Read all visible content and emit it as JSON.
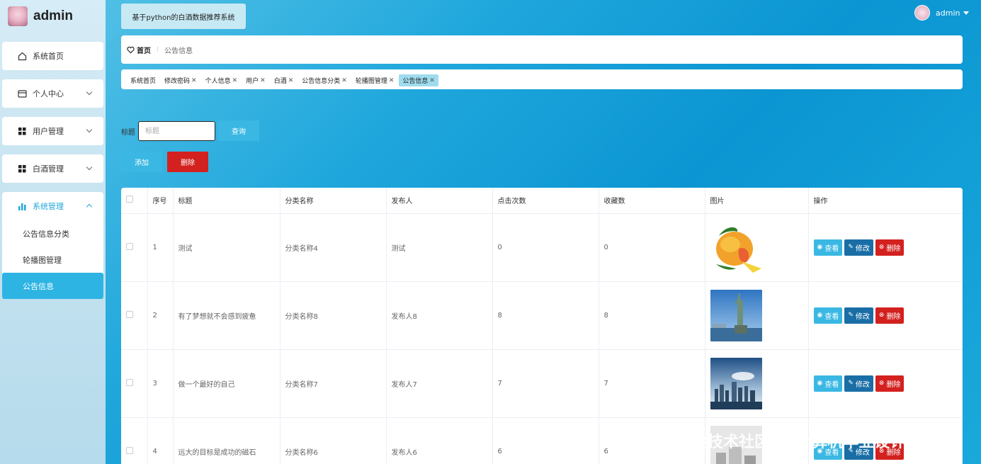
{
  "brand": {
    "title": "admin"
  },
  "header": {
    "system_title": "基于python的白酒数据推荐系统",
    "username": "admin"
  },
  "sidebar": {
    "items": [
      {
        "label": "系统首页",
        "icon": "home-icon"
      },
      {
        "label": "个人中心",
        "icon": "card-icon"
      },
      {
        "label": "用户管理",
        "icon": "grid-icon"
      },
      {
        "label": "白酒管理",
        "icon": "grid-icon"
      },
      {
        "label": "系统管理",
        "icon": "bar-chart-icon"
      }
    ],
    "sub_items": [
      {
        "label": "公告信息分类"
      },
      {
        "label": "轮播图管理"
      },
      {
        "label": "公告信息"
      }
    ]
  },
  "breadcrumb": {
    "home": "首页",
    "current": "公告信息"
  },
  "tabs": [
    {
      "label": "系统首页",
      "closable": false
    },
    {
      "label": "修改密码",
      "closable": true
    },
    {
      "label": "个人信息",
      "closable": true
    },
    {
      "label": "用户",
      "closable": true
    },
    {
      "label": "白酒",
      "closable": true
    },
    {
      "label": "公告信息分类",
      "closable": true
    },
    {
      "label": "轮播图管理",
      "closable": true
    },
    {
      "label": "公告信息",
      "closable": true
    }
  ],
  "search": {
    "label": "标题",
    "placeholder": "标题",
    "query_label": "查询"
  },
  "actions": {
    "add_label": "添加",
    "delete_label": "删除"
  },
  "table": {
    "columns": [
      "序号",
      "标题",
      "分类名称",
      "发布人",
      "点击次数",
      "收藏数",
      "图片",
      "操作"
    ],
    "rows": [
      {
        "index": "1",
        "title": "测试",
        "category": "分类名称4",
        "publisher": "测试",
        "clicks": "0",
        "favorites": "0",
        "image": "mango"
      },
      {
        "index": "2",
        "title": "有了梦想就不会感到疲惫",
        "category": "分类名称8",
        "publisher": "发布人8",
        "clicks": "8",
        "favorites": "8",
        "image": "statue-of-liberty"
      },
      {
        "index": "3",
        "title": "做一个最好的自己",
        "category": "分类名称7",
        "publisher": "发布人7",
        "clicks": "7",
        "favorites": "7",
        "image": "city-skyline"
      },
      {
        "index": "4",
        "title": "远大的目标是成功的磁石",
        "category": "分类名称6",
        "publisher": "发布人6",
        "clicks": "6",
        "favorites": "6",
        "image": "buildings"
      }
    ],
    "op_view": "查看",
    "op_edit": "修改",
    "op_delete": "删除"
  },
  "watermark": "掘金技术社区 @ 计算机毕业设计江挽",
  "colors": {
    "primary": "#3ab8e3",
    "danger": "#d3211f",
    "edit": "#1a6ea6"
  }
}
